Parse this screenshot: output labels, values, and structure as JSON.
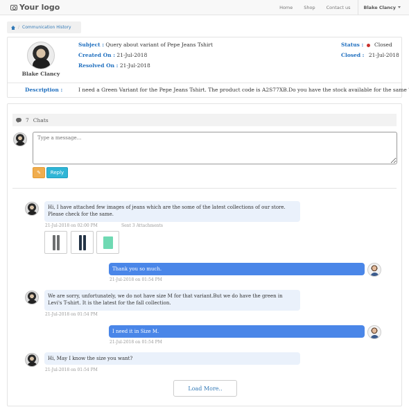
{
  "navbar": {
    "logo": "Your logo",
    "links": [
      "Home",
      "Shop",
      "Contact us"
    ],
    "user": "Blake Clancy"
  },
  "breadcrumb": {
    "current": "Communication History"
  },
  "ticket": {
    "user_name": "Blake Clancy",
    "subject_label": "Subject :",
    "subject": "Query about variant of Pepe Jeans Tshirt",
    "created_label": "Created On :",
    "created": "21-Jul-2018",
    "resolved_label": "Resolved On :",
    "resolved": "21-Jul-2018",
    "status_label": "Status :",
    "status": "Closed",
    "status_color": "#c9302c",
    "closed_label": "Closed :",
    "closed": "21-Jul-2018",
    "description_label": "Description :",
    "description": "I need a Green Variant for the Pepe Jeans Tshirt. The product code is A2S77XB.Do you have the stock available for the same ?"
  },
  "chat": {
    "count": "7",
    "count_label": "Chats",
    "input_placeholder": "Type a message...",
    "reply_label": "Reply",
    "load_more_label": "Load More..",
    "messages": [
      {
        "text": "Hi, I have attached few images of jeans which are the some of the latest collections of our store. Please check for the same.",
        "timestamp": "21-Jul-2018 on 02:00 PM",
        "attachments_note": "Sent 3 Attachments"
      },
      {
        "text": "Thank you so much.",
        "timestamp": "21-Jul-2018 on 01:54 PM"
      },
      {
        "text": "We are sorry, unfortunately, we do not have size M for that variant.But we do have the green in Levi's T-shirt. It is the latest for the fall collection.",
        "timestamp": "21-Jul-2018 on 01:54 PM"
      },
      {
        "text": "I need it in Size M.",
        "timestamp": "21-Jul-2018 on 01:54 PM"
      },
      {
        "text": "Hi, May I know the size you want?",
        "timestamp": "21-Jul-2018 on 01:54 PM"
      }
    ]
  },
  "colors": {
    "accent": "#337ab7",
    "outgoing_bubble": "#4a86e8",
    "incoming_bubble": "#eaf1fb",
    "reply_button": "#2fb5d6",
    "attach_button": "#f0ad4e"
  },
  "icons": [
    "camera-icon",
    "home-icon",
    "comments-icon",
    "paperclip-icon",
    "caret-down-icon"
  ]
}
